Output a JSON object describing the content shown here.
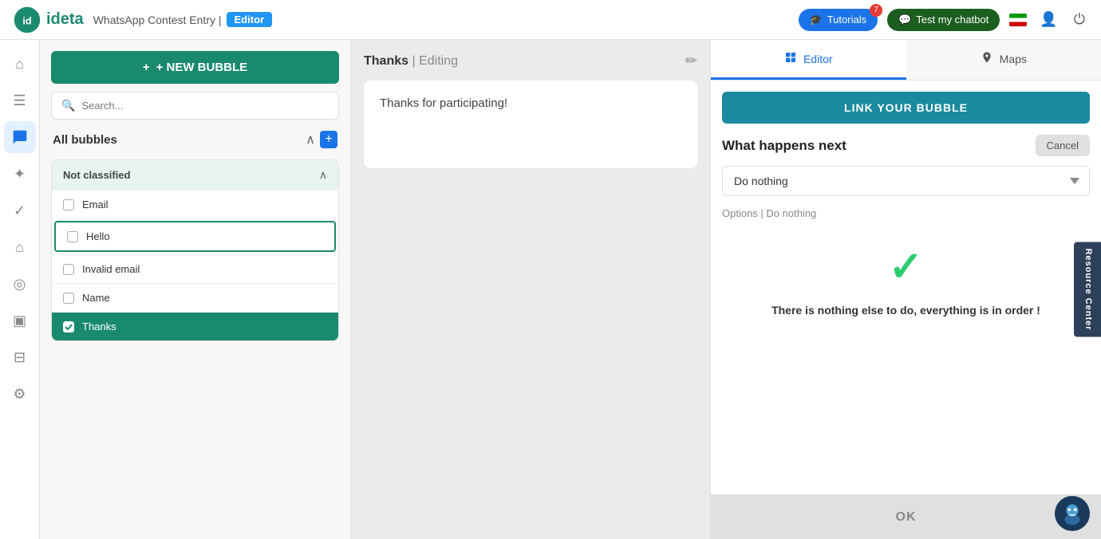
{
  "header": {
    "logo_text": "ideta",
    "title": "WhatsApp Contest Entry |",
    "editor_badge": "Editor",
    "tutorials_label": "Tutorials",
    "tutorials_count": "7",
    "test_chatbot_label": "Test my chatbot"
  },
  "bubbles_panel": {
    "new_bubble_btn": "+ NEW BUBBLE",
    "search_placeholder": "Search...",
    "all_bubbles_title": "All bubbles",
    "group_title": "Not classified",
    "bubbles": [
      {
        "id": "email",
        "label": "Email",
        "selected": false,
        "highlighted": false
      },
      {
        "id": "hello",
        "label": "Hello",
        "selected": false,
        "highlighted": true
      },
      {
        "id": "invalid-email",
        "label": "Invalid email",
        "selected": false,
        "highlighted": false
      },
      {
        "id": "name",
        "label": "Name",
        "selected": false,
        "highlighted": false
      },
      {
        "id": "thanks",
        "label": "Thanks",
        "selected": true,
        "highlighted": false
      }
    ]
  },
  "editing_panel": {
    "title": "Thanks",
    "subtitle": "| Editing",
    "message": "Thanks for participating!"
  },
  "right_panel": {
    "tab_editor": "Editor",
    "tab_maps": "Maps",
    "link_bubble_btn": "LINK YOUR BUBBLE",
    "what_happens_title": "What happens next",
    "cancel_label": "Cancel",
    "select_option": "Do nothing",
    "options_label": "Options | Do nothing",
    "nothing_to_do_text": "There is nothing else to do, everything is in order !",
    "ok_label": "OK"
  },
  "resource_center": "Resource Center",
  "nav_items": [
    {
      "id": "home",
      "icon": "⌂",
      "active": false
    },
    {
      "id": "list",
      "icon": "☰",
      "active": false
    },
    {
      "id": "bubble",
      "icon": "💬",
      "active": true
    },
    {
      "id": "star",
      "icon": "✦",
      "active": false
    },
    {
      "id": "check",
      "icon": "✓",
      "active": false
    },
    {
      "id": "home2",
      "icon": "⌂",
      "active": false
    },
    {
      "id": "chat",
      "icon": "◎",
      "active": false
    },
    {
      "id": "bar",
      "icon": "▣",
      "active": false
    },
    {
      "id": "db",
      "icon": "⊟",
      "active": false
    },
    {
      "id": "gear",
      "icon": "⚙",
      "active": false
    }
  ]
}
